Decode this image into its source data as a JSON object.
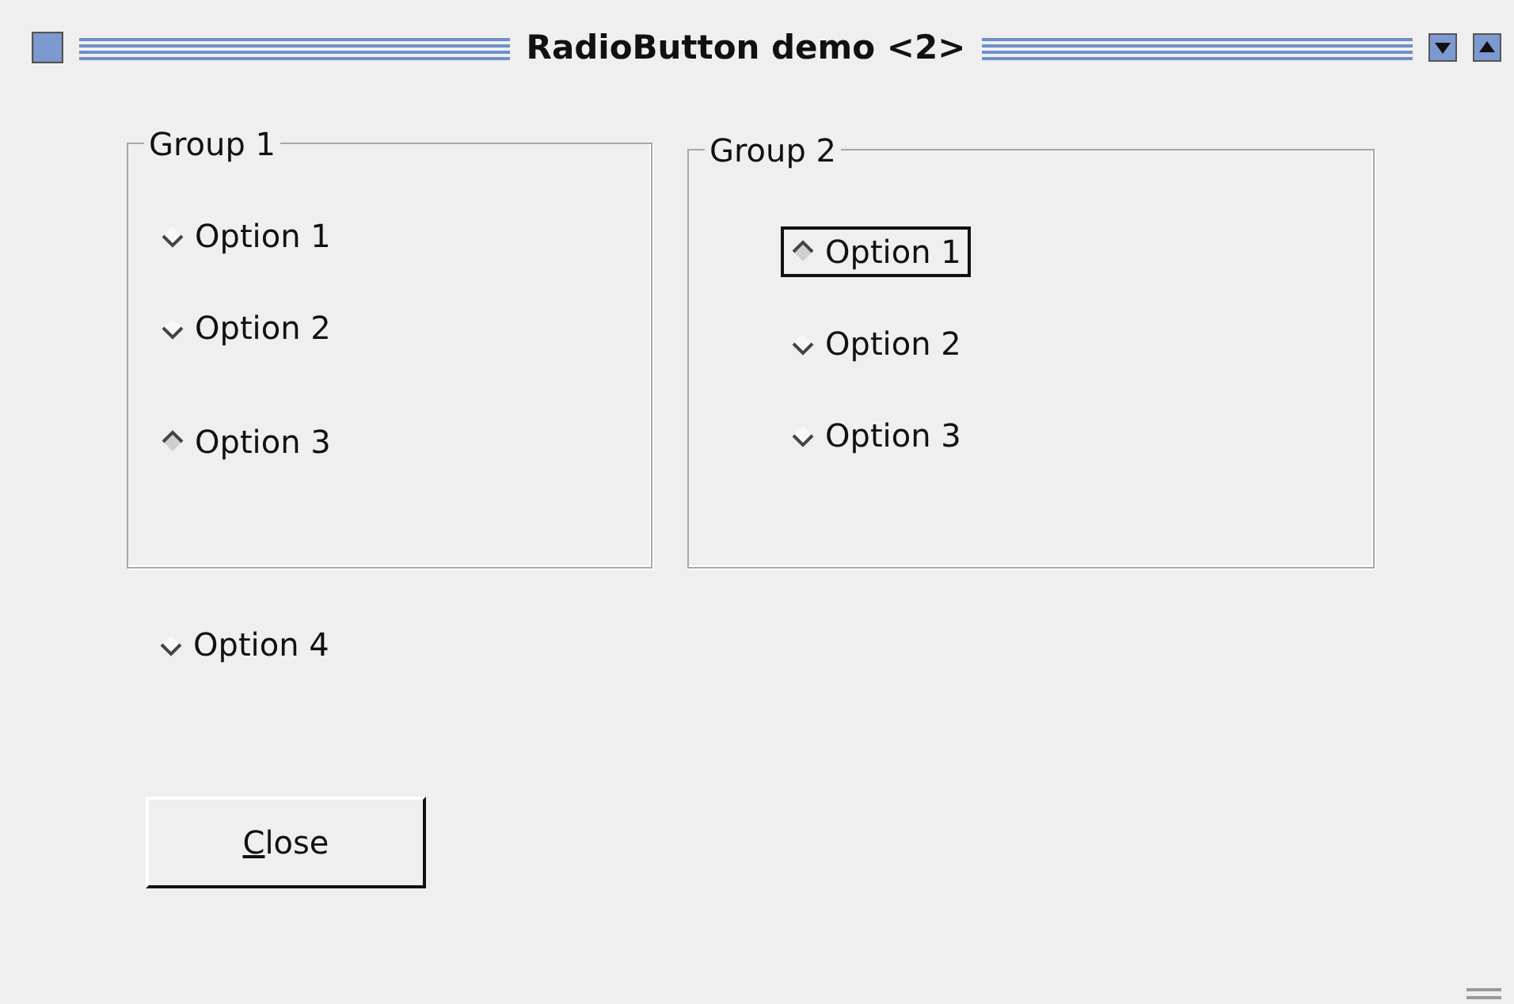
{
  "window": {
    "title": "RadioButton demo <2>"
  },
  "groups": [
    {
      "title": "Group 1",
      "options": [
        {
          "label": "Option 1",
          "selected": false,
          "focused": false
        },
        {
          "label": "Option 2",
          "selected": false,
          "focused": false
        },
        {
          "label": "Option 3",
          "selected": true,
          "focused": false
        }
      ]
    },
    {
      "title": "Group 2",
      "options": [
        {
          "label": "Option 1",
          "selected": true,
          "focused": true
        },
        {
          "label": "Option 2",
          "selected": false,
          "focused": false
        },
        {
          "label": "Option 3",
          "selected": false,
          "focused": false
        }
      ]
    }
  ],
  "loose_option": {
    "label": "Option 4",
    "selected": false,
    "focused": false
  },
  "close_button": {
    "mnemonic": "C",
    "rest": "lose"
  }
}
